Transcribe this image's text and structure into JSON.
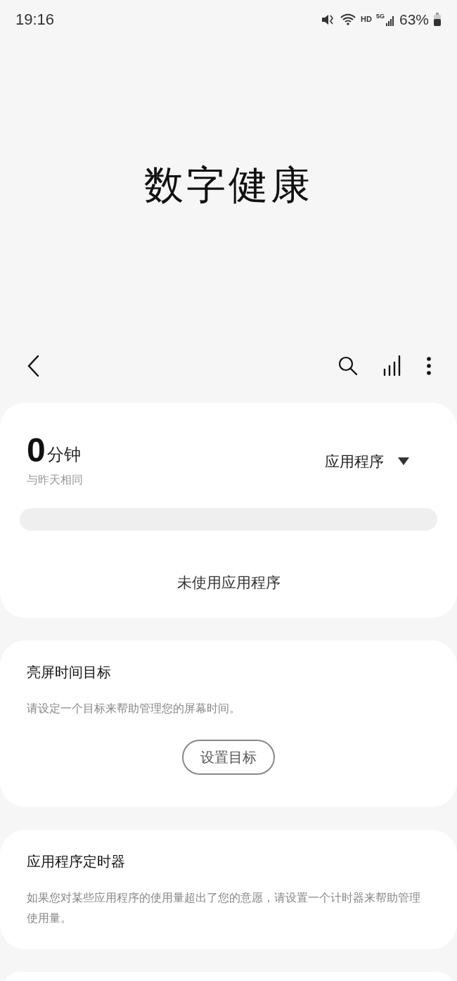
{
  "status_bar": {
    "time": "19:16",
    "battery": "63%",
    "network": "5G",
    "wifi_label": "HD"
  },
  "title": "数字健康",
  "toolbar": {
    "actions": [
      {
        "kind": "search"
      },
      {
        "kind": "chart"
      },
      {
        "kind": "more"
      }
    ]
  },
  "usage_card": {
    "value": "0",
    "unit": "分钟",
    "comparison": "与昨天相同",
    "filter": "应用程序",
    "empty_message": "未使用应用程序"
  },
  "cards": [
    {
      "title": "亮屏时间目标",
      "description": "请设定一个目标来帮助管理您的屏幕时间。",
      "button": "设置目标"
    },
    {
      "title": "应用程序定时器",
      "description": "如果您对某些应用程序的使用量超出了您的意愿，请设置一个计时器来帮助管理使用量。"
    }
  ]
}
